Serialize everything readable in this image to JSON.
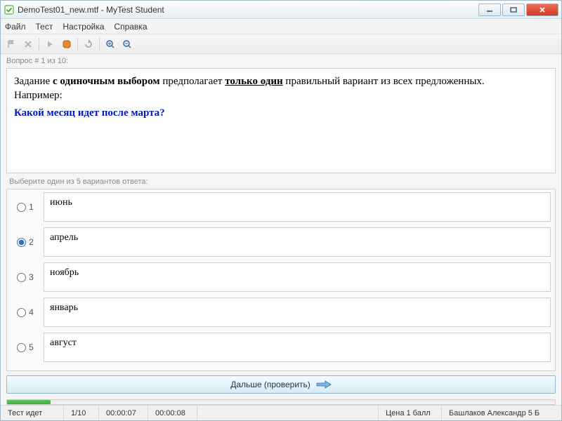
{
  "titlebar": {
    "title": "DemoTest01_new.mtf - MyTest Student"
  },
  "menu": {
    "file": "Файл",
    "test": "Тест",
    "settings": "Настройка",
    "help": "Справка"
  },
  "progress_label": "Вопрос # 1 из 10:",
  "question": {
    "line1_pre": "Задание ",
    "line1_bold": "с одиночным выбором",
    "line1_mid": " предполагает ",
    "line1_under": "только один",
    "line1_post": " правильный вариант из всех предложенных.",
    "line2": "Например:",
    "prompt": "Какой месяц идет после марта?"
  },
  "answers_label": "Выберите один из 5 вариантов ответа:",
  "answers": [
    {
      "num": "1",
      "text": "июнь",
      "selected": false
    },
    {
      "num": "2",
      "text": "апрель",
      "selected": true
    },
    {
      "num": "3",
      "text": "ноябрь",
      "selected": false
    },
    {
      "num": "4",
      "text": "январь",
      "selected": false
    },
    {
      "num": "5",
      "text": "август",
      "selected": false
    }
  ],
  "next_button": "Дальше (проверить)",
  "status": {
    "state": "Тест идет",
    "counter": "1/10",
    "elapsed": "00:00:07",
    "total": "00:00:08",
    "price": "Цена 1 балл",
    "author": "Башлаков Александр 5 Б"
  }
}
